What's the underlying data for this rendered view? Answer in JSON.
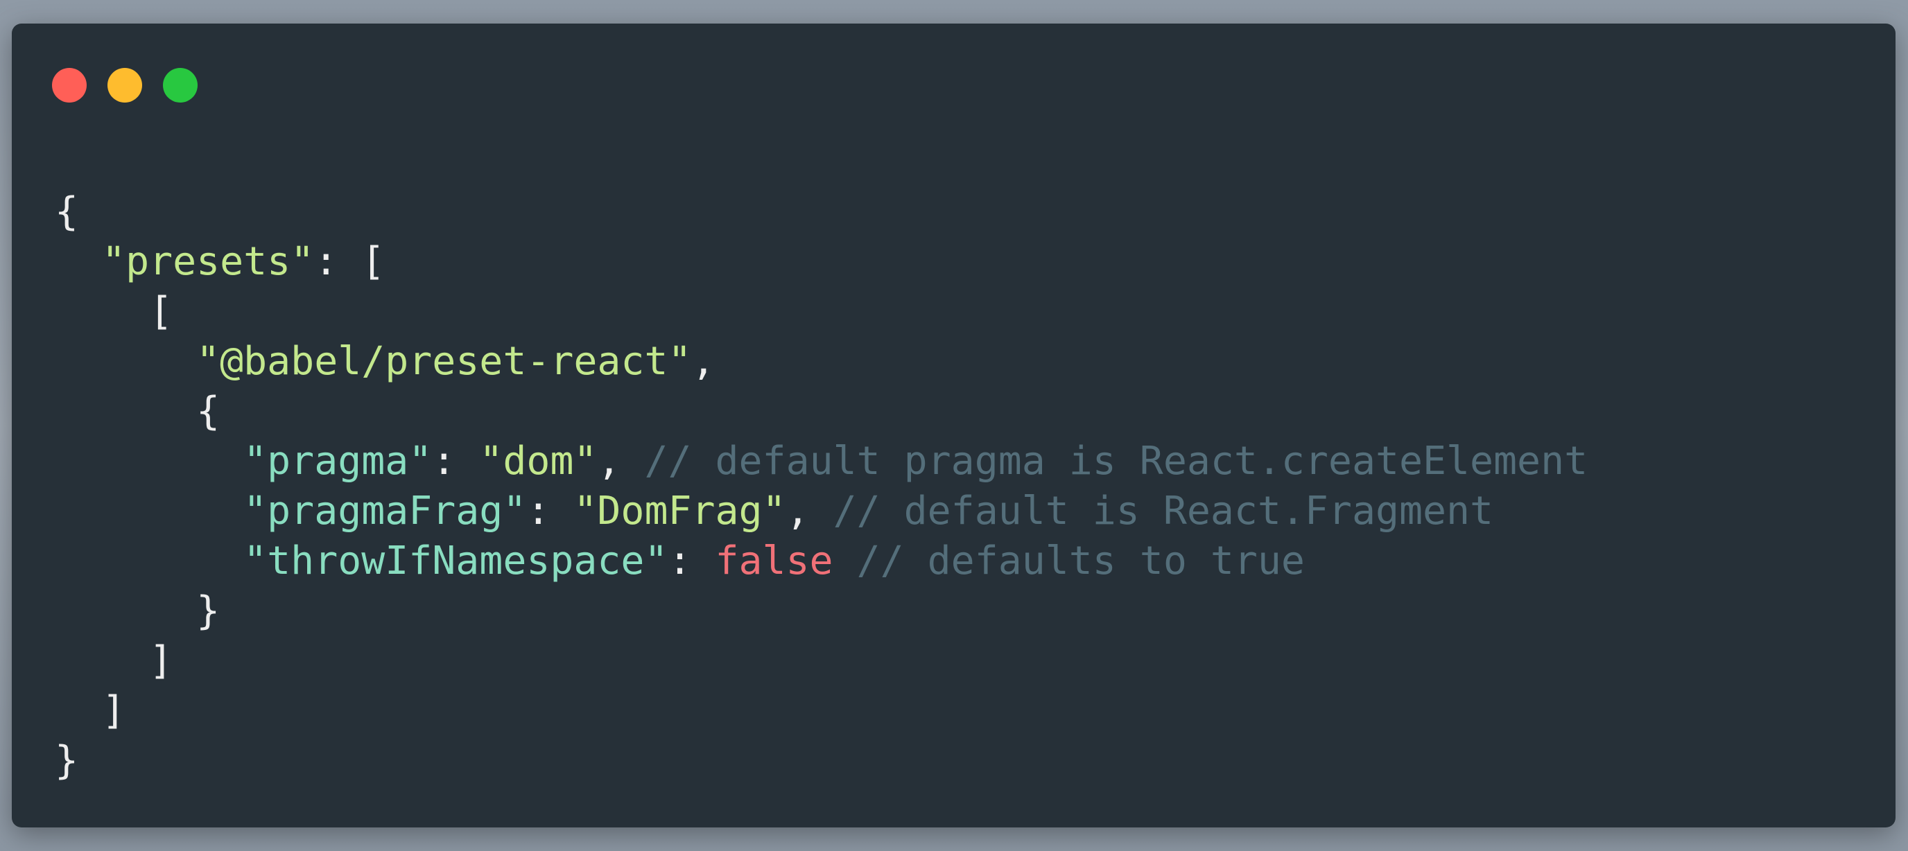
{
  "window": {
    "controls": [
      {
        "name": "close",
        "color": "#ff5f57"
      },
      {
        "name": "minimize",
        "color": "#febc2e"
      },
      {
        "name": "maximize",
        "color": "#28c840"
      }
    ]
  },
  "code": {
    "lines": [
      {
        "indent": "",
        "tokens": [
          {
            "t": "{",
            "k": "punc"
          }
        ]
      },
      {
        "indent": "  ",
        "tokens": [
          {
            "t": "\"presets\"",
            "k": "str"
          },
          {
            "t": ": [",
            "k": "punc"
          }
        ]
      },
      {
        "indent": "    ",
        "tokens": [
          {
            "t": "[",
            "k": "punc"
          }
        ]
      },
      {
        "indent": "      ",
        "tokens": [
          {
            "t": "\"@babel/preset-react\"",
            "k": "str"
          },
          {
            "t": ",",
            "k": "punc"
          }
        ]
      },
      {
        "indent": "      ",
        "tokens": [
          {
            "t": "{",
            "k": "punc"
          }
        ]
      },
      {
        "indent": "        ",
        "tokens": [
          {
            "t": "\"pragma\"",
            "k": "key"
          },
          {
            "t": ": ",
            "k": "punc"
          },
          {
            "t": "\"dom\"",
            "k": "str"
          },
          {
            "t": ", ",
            "k": "punc"
          },
          {
            "t": "// default pragma is React.createElement",
            "k": "cmt"
          }
        ]
      },
      {
        "indent": "        ",
        "tokens": [
          {
            "t": "\"pragmaFrag\"",
            "k": "key"
          },
          {
            "t": ": ",
            "k": "punc"
          },
          {
            "t": "\"DomFrag\"",
            "k": "str"
          },
          {
            "t": ", ",
            "k": "punc"
          },
          {
            "t": "// default is React.Fragment",
            "k": "cmt"
          }
        ]
      },
      {
        "indent": "        ",
        "tokens": [
          {
            "t": "\"throwIfNamespace\"",
            "k": "key"
          },
          {
            "t": ": ",
            "k": "punc"
          },
          {
            "t": "false",
            "k": "bool"
          },
          {
            "t": " ",
            "k": "punc"
          },
          {
            "t": "// defaults to true",
            "k": "cmt"
          }
        ]
      },
      {
        "indent": "      ",
        "tokens": [
          {
            "t": "}",
            "k": "punc"
          }
        ]
      },
      {
        "indent": "    ",
        "tokens": [
          {
            "t": "]",
            "k": "punc"
          }
        ]
      },
      {
        "indent": "  ",
        "tokens": [
          {
            "t": "]",
            "k": "punc"
          }
        ]
      },
      {
        "indent": "",
        "tokens": [
          {
            "t": "}",
            "k": "punc"
          }
        ]
      }
    ]
  },
  "theme": {
    "background": "#263038",
    "punctuation": "#eeeeee",
    "string": "#c3e88d",
    "property_key": "#89ddc0",
    "boolean": "#f07178",
    "comment": "#546e7a"
  }
}
